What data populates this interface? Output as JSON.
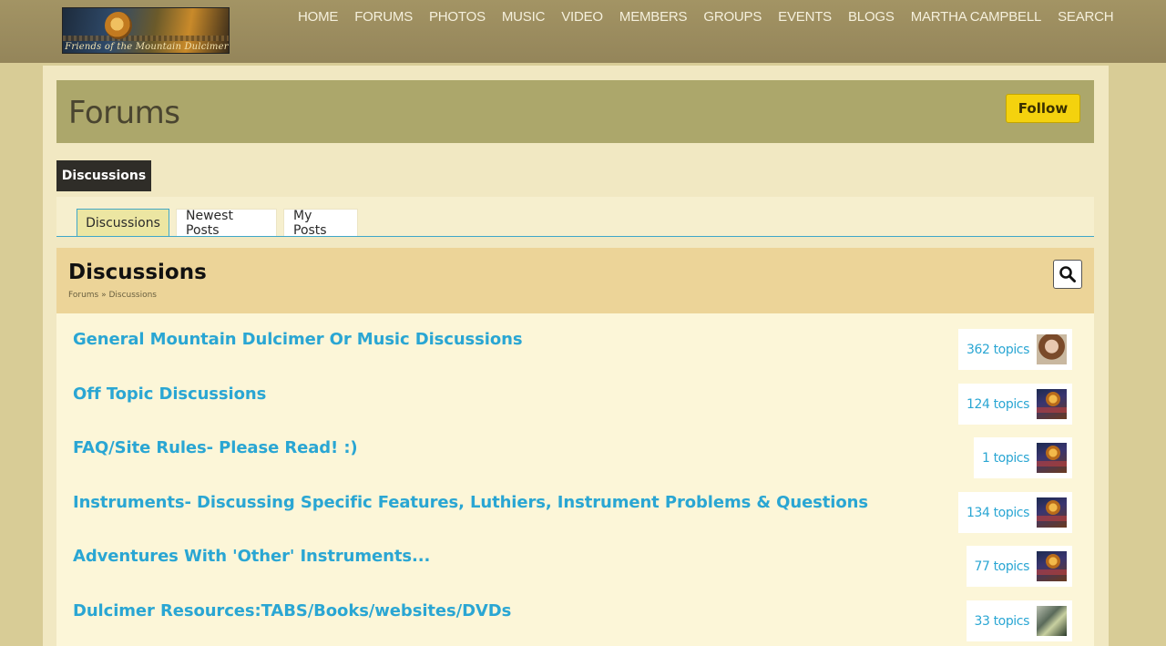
{
  "header": {
    "logo_text": "Friends of the Mountain Dulcimer",
    "nav": [
      "HOME",
      "FORUMS",
      "PHOTOS",
      "MUSIC",
      "VIDEO",
      "MEMBERS",
      "GROUPS",
      "EVENTS",
      "BLOGS",
      "MARTHA CAMPBELL",
      "SEARCH"
    ]
  },
  "page": {
    "title": "Forums",
    "follow_label": "Follow",
    "section_tab": "Discussions"
  },
  "subtabs": [
    {
      "label": "Discussions",
      "active": true
    },
    {
      "label": "Newest Posts",
      "active": false
    },
    {
      "label": "My Posts",
      "active": false
    }
  ],
  "discussions": {
    "title": "Discussions",
    "breadcrumb": "Forums » Discussions",
    "rows": [
      {
        "title": "General Mountain Dulcimer Or Music Discussions",
        "topics": "362 topics",
        "avatar": "person"
      },
      {
        "title": "Off Topic Discussions",
        "topics": "124 topics",
        "avatar": "logo"
      },
      {
        "title": "FAQ/Site Rules- Please Read! :)",
        "topics": "1 topics",
        "avatar": "logo"
      },
      {
        "title": "Instruments- Discussing Specific Features, Luthiers, Instrument Problems & Questions",
        "topics": "134 topics",
        "avatar": "logo"
      },
      {
        "title": "Adventures With 'Other' Instruments...",
        "topics": "77 topics",
        "avatar": "logo"
      },
      {
        "title": "Dulcimer Resources:TABS/Books/websites/DVDs",
        "topics": "33 topics",
        "avatar": "photo"
      }
    ]
  },
  "colors": {
    "link": "#2aa6d3",
    "follow_button": "#f4d20e",
    "title_band": "#aca76b"
  }
}
